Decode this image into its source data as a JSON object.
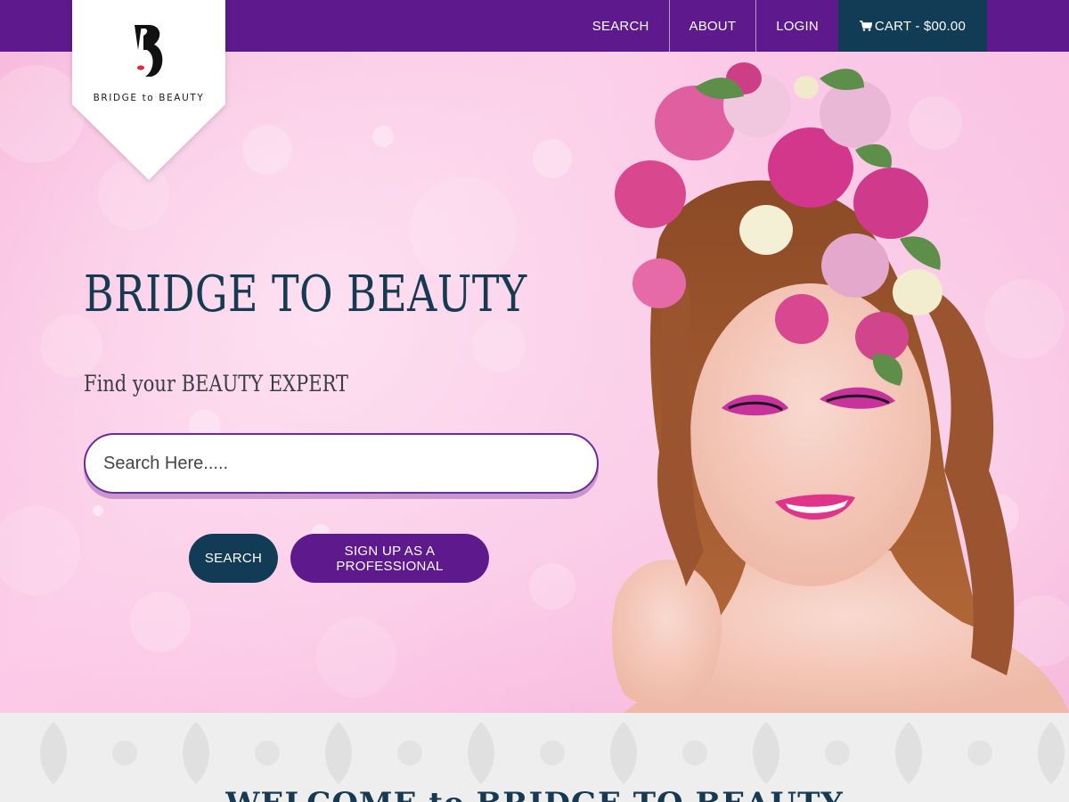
{
  "brand": {
    "logo_text": "BRIDGE to BEAUTY",
    "primary_color": "#5e1a8c",
    "secondary_color": "#123c55",
    "heading_color": "#173a52"
  },
  "nav": {
    "items": [
      {
        "label": "SEARCH"
      },
      {
        "label": "ABOUT"
      },
      {
        "label": "LOGIN"
      }
    ],
    "cart_label": "CART - $00.00",
    "cart_icon": "shopping-cart-icon"
  },
  "hero": {
    "title": "BRIDGE TO BEAUTY",
    "subtitle": "Find your BEAUTY EXPERT",
    "search_placeholder": "Search Here.....",
    "search_value": "",
    "search_button": "SEARCH",
    "signup_button": "SIGN UP AS A PROFESSIONAL",
    "image": "woman-with-flower-crown-photo"
  },
  "welcome": {
    "title": "WELCOME to BRIDGE TO BEAUTY"
  }
}
